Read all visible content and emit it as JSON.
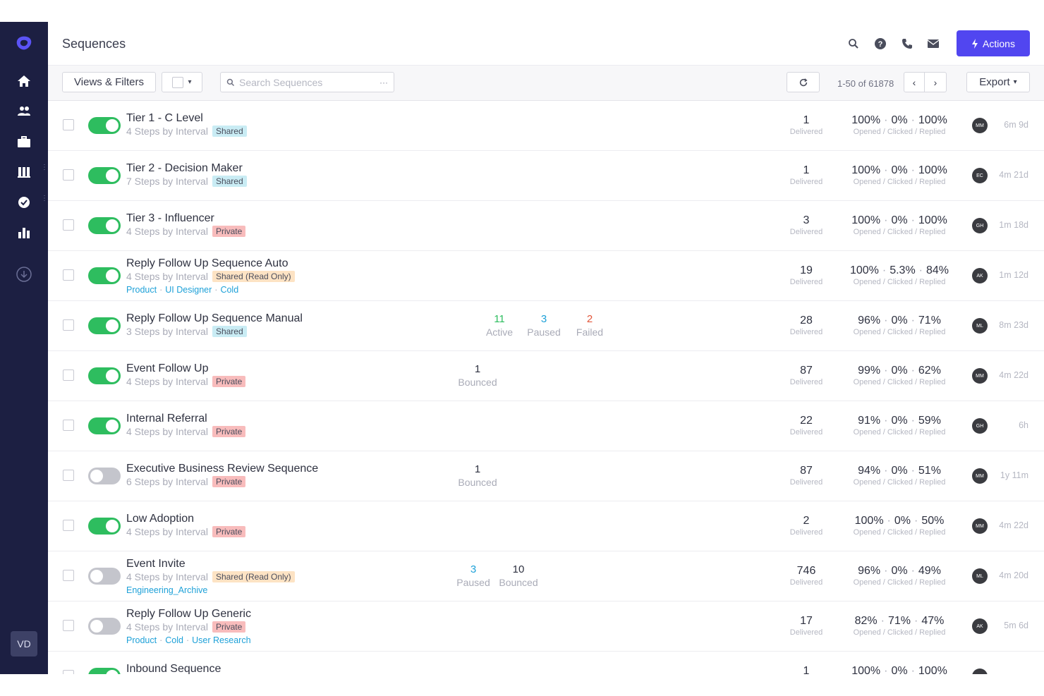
{
  "app": {
    "title": "Sequences",
    "user_initials": "VD"
  },
  "header": {
    "actions_label": "Actions"
  },
  "toolbar": {
    "views_label": "Views & Filters",
    "search_placeholder": "Search Sequences",
    "search_more": "···",
    "pagination": "1-50 of 61878",
    "export_label": "Export"
  },
  "sequences": [
    {
      "name": "Tier 1 - C Level",
      "steps": "4 Steps by Interval",
      "badge": "Shared",
      "badge_type": "shared",
      "enabled": true,
      "tags": [],
      "stats": [],
      "delivered": "1",
      "opened": "100%",
      "clicked": "0%",
      "replied": "100%",
      "owner": "MM",
      "age": "6m 9d"
    },
    {
      "name": "Tier 2 - Decision Maker",
      "steps": "7 Steps by Interval",
      "badge": "Shared",
      "badge_type": "shared",
      "enabled": true,
      "tags": [],
      "stats": [],
      "delivered": "1",
      "opened": "100%",
      "clicked": "0%",
      "replied": "100%",
      "owner": "EC",
      "age": "4m 21d"
    },
    {
      "name": "Tier 3 - Influencer",
      "steps": "4 Steps by Interval",
      "badge": "Private",
      "badge_type": "private",
      "enabled": true,
      "tags": [],
      "stats": [],
      "delivered": "3",
      "opened": "100%",
      "clicked": "0%",
      "replied": "100%",
      "owner": "GH",
      "age": "1m 18d"
    },
    {
      "name": "Reply Follow Up Sequence Auto",
      "steps": "4 Steps by Interval",
      "badge": "Shared (Read Only)",
      "badge_type": "readonly",
      "enabled": true,
      "tags": [
        "Product",
        "UI Designer",
        "Cold"
      ],
      "stats": [],
      "delivered": "19",
      "opened": "100%",
      "clicked": "5.3%",
      "replied": "84%",
      "owner": "AK",
      "age": "1m 12d"
    },
    {
      "name": "Reply Follow Up Sequence Manual",
      "steps": "3 Steps by Interval",
      "badge": "Shared",
      "badge_type": "shared",
      "enabled": true,
      "tags": [],
      "stats": [
        {
          "value": "11",
          "label": "Active",
          "color": "green"
        },
        {
          "value": "3",
          "label": "Paused",
          "color": "blue"
        },
        {
          "value": "2",
          "label": "Failed",
          "color": "red"
        }
      ],
      "delivered": "28",
      "opened": "96%",
      "clicked": "0%",
      "replied": "71%",
      "owner": "ML",
      "age": "8m 23d"
    },
    {
      "name": "Event Follow Up",
      "steps": "4 Steps by Interval",
      "badge": "Private",
      "badge_type": "private",
      "enabled": true,
      "tags": [],
      "stats": [
        {
          "value": "1",
          "label": "Bounced",
          "color": ""
        }
      ],
      "delivered": "87",
      "opened": "99%",
      "clicked": "0%",
      "replied": "62%",
      "owner": "MM",
      "age": "4m 22d"
    },
    {
      "name": "Internal Referral",
      "steps": "4 Steps by Interval",
      "badge": "Private",
      "badge_type": "private",
      "enabled": true,
      "tags": [],
      "stats": [],
      "delivered": "22",
      "opened": "91%",
      "clicked": "0%",
      "replied": "59%",
      "owner": "GH",
      "age": "6h"
    },
    {
      "name": "Executive Business Review Sequence",
      "steps": "6 Steps by Interval",
      "badge": "Private",
      "badge_type": "private",
      "enabled": false,
      "tags": [],
      "stats": [
        {
          "value": "1",
          "label": "Bounced",
          "color": ""
        }
      ],
      "delivered": "87",
      "opened": "94%",
      "clicked": "0%",
      "replied": "51%",
      "owner": "MM",
      "age": "1y 11m"
    },
    {
      "name": "Low Adoption",
      "steps": "4 Steps by Interval",
      "badge": "Private",
      "badge_type": "private",
      "enabled": true,
      "tags": [],
      "stats": [],
      "delivered": "2",
      "opened": "100%",
      "clicked": "0%",
      "replied": "50%",
      "owner": "MM",
      "age": "4m 22d"
    },
    {
      "name": "Event Invite",
      "steps": "4 Steps by Interval",
      "badge": "Shared (Read Only)",
      "badge_type": "readonly",
      "enabled": false,
      "tags": [
        "Engineering_Archive"
      ],
      "stats": [
        {
          "value": "3",
          "label": "Paused",
          "color": "blue"
        },
        {
          "value": "10",
          "label": "Bounced",
          "color": ""
        }
      ],
      "delivered": "746",
      "opened": "96%",
      "clicked": "0%",
      "replied": "49%",
      "owner": "ML",
      "age": "4m 20d"
    },
    {
      "name": "Reply Follow Up Generic",
      "steps": "4 Steps by Interval",
      "badge": "Private",
      "badge_type": "private",
      "enabled": false,
      "tags": [
        "Product",
        "Cold",
        "User Research"
      ],
      "stats": [],
      "delivered": "17",
      "opened": "82%",
      "clicked": "71%",
      "replied": "47%",
      "owner": "AK",
      "age": "5m 6d"
    },
    {
      "name": "Inbound Sequence",
      "steps": "",
      "badge": "",
      "badge_type": "",
      "enabled": true,
      "tags": [],
      "stats": [],
      "delivered": "1",
      "opened": "100%",
      "clicked": "0%",
      "replied": "100%",
      "owner": "MM",
      "age": ""
    }
  ],
  "labels": {
    "delivered": "Delivered",
    "rates": "Opened / Clicked / Replied"
  },
  "colors": {
    "sidebar": "#1c1f42",
    "accent": "#5146f0",
    "toggle_on": "#2ebd5f",
    "link": "#1ea1d8"
  }
}
